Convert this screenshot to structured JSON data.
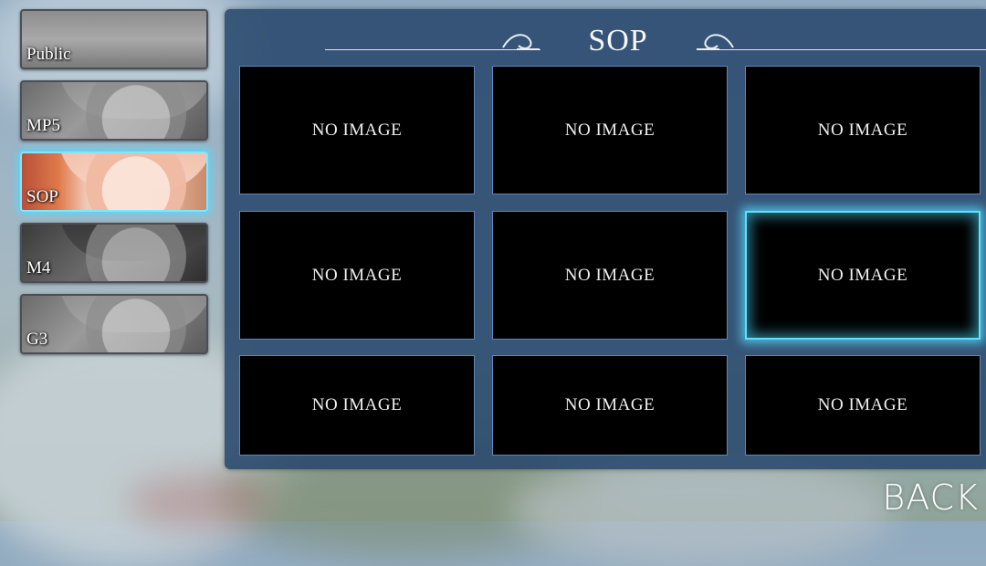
{
  "sidebar": {
    "items": [
      {
        "label": "Public",
        "active": false
      },
      {
        "label": "MP5",
        "active": false
      },
      {
        "label": "SOP",
        "active": true
      },
      {
        "label": "M4",
        "active": false
      },
      {
        "label": "G3",
        "active": false
      }
    ]
  },
  "panel": {
    "title": "SOP",
    "cells": [
      "NO IMAGE",
      "NO IMAGE",
      "NO IMAGE",
      "NO IMAGE",
      "NO IMAGE",
      "NO IMAGE",
      "NO IMAGE",
      "NO IMAGE",
      "NO IMAGE"
    ],
    "selected_index": 5
  },
  "footer": {
    "back_label": "BACK"
  },
  "colors": {
    "accent": "#5fe0ff",
    "panel": "#28486c",
    "cell_border": "#5f86b8"
  }
}
